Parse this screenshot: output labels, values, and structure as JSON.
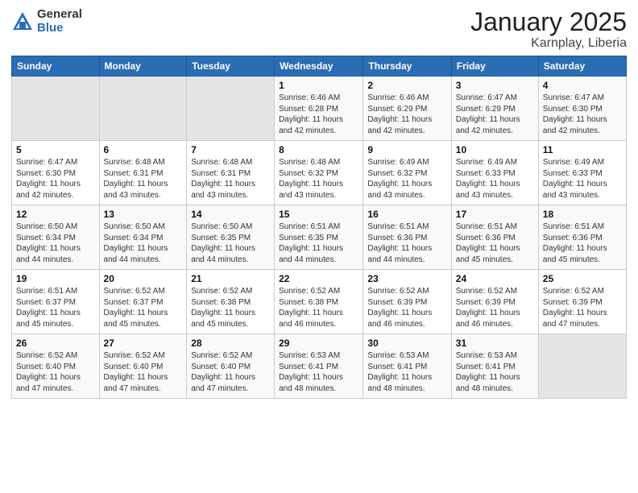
{
  "logo": {
    "general": "General",
    "blue": "Blue"
  },
  "title": "January 2025",
  "subtitle": "Karnplay, Liberia",
  "days_of_week": [
    "Sunday",
    "Monday",
    "Tuesday",
    "Wednesday",
    "Thursday",
    "Friday",
    "Saturday"
  ],
  "weeks": [
    [
      {
        "num": "",
        "info": ""
      },
      {
        "num": "",
        "info": ""
      },
      {
        "num": "",
        "info": ""
      },
      {
        "num": "1",
        "info": "Sunrise: 6:46 AM\nSunset: 6:28 PM\nDaylight: 11 hours\nand 42 minutes."
      },
      {
        "num": "2",
        "info": "Sunrise: 6:46 AM\nSunset: 6:29 PM\nDaylight: 11 hours\nand 42 minutes."
      },
      {
        "num": "3",
        "info": "Sunrise: 6:47 AM\nSunset: 6:29 PM\nDaylight: 11 hours\nand 42 minutes."
      },
      {
        "num": "4",
        "info": "Sunrise: 6:47 AM\nSunset: 6:30 PM\nDaylight: 11 hours\nand 42 minutes."
      }
    ],
    [
      {
        "num": "5",
        "info": "Sunrise: 6:47 AM\nSunset: 6:30 PM\nDaylight: 11 hours\nand 42 minutes."
      },
      {
        "num": "6",
        "info": "Sunrise: 6:48 AM\nSunset: 6:31 PM\nDaylight: 11 hours\nand 43 minutes."
      },
      {
        "num": "7",
        "info": "Sunrise: 6:48 AM\nSunset: 6:31 PM\nDaylight: 11 hours\nand 43 minutes."
      },
      {
        "num": "8",
        "info": "Sunrise: 6:48 AM\nSunset: 6:32 PM\nDaylight: 11 hours\nand 43 minutes."
      },
      {
        "num": "9",
        "info": "Sunrise: 6:49 AM\nSunset: 6:32 PM\nDaylight: 11 hours\nand 43 minutes."
      },
      {
        "num": "10",
        "info": "Sunrise: 6:49 AM\nSunset: 6:33 PM\nDaylight: 11 hours\nand 43 minutes."
      },
      {
        "num": "11",
        "info": "Sunrise: 6:49 AM\nSunset: 6:33 PM\nDaylight: 11 hours\nand 43 minutes."
      }
    ],
    [
      {
        "num": "12",
        "info": "Sunrise: 6:50 AM\nSunset: 6:34 PM\nDaylight: 11 hours\nand 44 minutes."
      },
      {
        "num": "13",
        "info": "Sunrise: 6:50 AM\nSunset: 6:34 PM\nDaylight: 11 hours\nand 44 minutes."
      },
      {
        "num": "14",
        "info": "Sunrise: 6:50 AM\nSunset: 6:35 PM\nDaylight: 11 hours\nand 44 minutes."
      },
      {
        "num": "15",
        "info": "Sunrise: 6:51 AM\nSunset: 6:35 PM\nDaylight: 11 hours\nand 44 minutes."
      },
      {
        "num": "16",
        "info": "Sunrise: 6:51 AM\nSunset: 6:36 PM\nDaylight: 11 hours\nand 44 minutes."
      },
      {
        "num": "17",
        "info": "Sunrise: 6:51 AM\nSunset: 6:36 PM\nDaylight: 11 hours\nand 45 minutes."
      },
      {
        "num": "18",
        "info": "Sunrise: 6:51 AM\nSunset: 6:36 PM\nDaylight: 11 hours\nand 45 minutes."
      }
    ],
    [
      {
        "num": "19",
        "info": "Sunrise: 6:51 AM\nSunset: 6:37 PM\nDaylight: 11 hours\nand 45 minutes."
      },
      {
        "num": "20",
        "info": "Sunrise: 6:52 AM\nSunset: 6:37 PM\nDaylight: 11 hours\nand 45 minutes."
      },
      {
        "num": "21",
        "info": "Sunrise: 6:52 AM\nSunset: 6:38 PM\nDaylight: 11 hours\nand 45 minutes."
      },
      {
        "num": "22",
        "info": "Sunrise: 6:52 AM\nSunset: 6:38 PM\nDaylight: 11 hours\nand 46 minutes."
      },
      {
        "num": "23",
        "info": "Sunrise: 6:52 AM\nSunset: 6:39 PM\nDaylight: 11 hours\nand 46 minutes."
      },
      {
        "num": "24",
        "info": "Sunrise: 6:52 AM\nSunset: 6:39 PM\nDaylight: 11 hours\nand 46 minutes."
      },
      {
        "num": "25",
        "info": "Sunrise: 6:52 AM\nSunset: 6:39 PM\nDaylight: 11 hours\nand 47 minutes."
      }
    ],
    [
      {
        "num": "26",
        "info": "Sunrise: 6:52 AM\nSunset: 6:40 PM\nDaylight: 11 hours\nand 47 minutes."
      },
      {
        "num": "27",
        "info": "Sunrise: 6:52 AM\nSunset: 6:40 PM\nDaylight: 11 hours\nand 47 minutes."
      },
      {
        "num": "28",
        "info": "Sunrise: 6:52 AM\nSunset: 6:40 PM\nDaylight: 11 hours\nand 47 minutes."
      },
      {
        "num": "29",
        "info": "Sunrise: 6:53 AM\nSunset: 6:41 PM\nDaylight: 11 hours\nand 48 minutes."
      },
      {
        "num": "30",
        "info": "Sunrise: 6:53 AM\nSunset: 6:41 PM\nDaylight: 11 hours\nand 48 minutes."
      },
      {
        "num": "31",
        "info": "Sunrise: 6:53 AM\nSunset: 6:41 PM\nDaylight: 11 hours\nand 48 minutes."
      },
      {
        "num": "",
        "info": ""
      }
    ]
  ]
}
